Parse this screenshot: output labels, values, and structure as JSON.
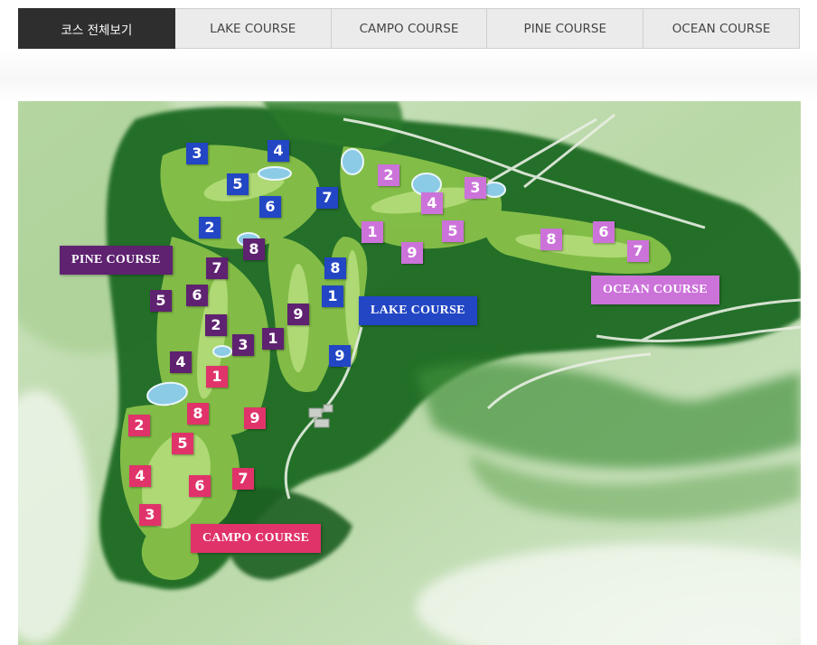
{
  "tabs": [
    {
      "label": "코스 전체보기",
      "active": true
    },
    {
      "label": "LAKE COURSE",
      "active": false
    },
    {
      "label": "CAMPO COURSE",
      "active": false
    },
    {
      "label": "PINE COURSE",
      "active": false
    },
    {
      "label": "OCEAN COURSE",
      "active": false
    }
  ],
  "colors": {
    "lake": "#2246c4",
    "campo": "#e0336a",
    "pine": "#5e2270",
    "ocean": "#cc73da",
    "tab_active": "#2e2e2e",
    "tab_inactive": "#ebebeb"
  },
  "courses": {
    "lake": {
      "name": "LAKE COURSE",
      "holes": [
        "1",
        "2",
        "3",
        "4",
        "5",
        "6",
        "7",
        "8",
        "9"
      ]
    },
    "campo": {
      "name": "CAMPO COURSE",
      "holes": [
        "1",
        "2",
        "3",
        "4",
        "5",
        "6",
        "7",
        "8",
        "9"
      ]
    },
    "pine": {
      "name": "PINE COURSE",
      "holes": [
        "1",
        "2",
        "3",
        "4",
        "5",
        "6",
        "7",
        "8",
        "9"
      ]
    },
    "ocean": {
      "name": "OCEAN COURSE",
      "holes": [
        "1",
        "2",
        "3",
        "4",
        "5",
        "6",
        "7",
        "8",
        "9"
      ]
    }
  }
}
